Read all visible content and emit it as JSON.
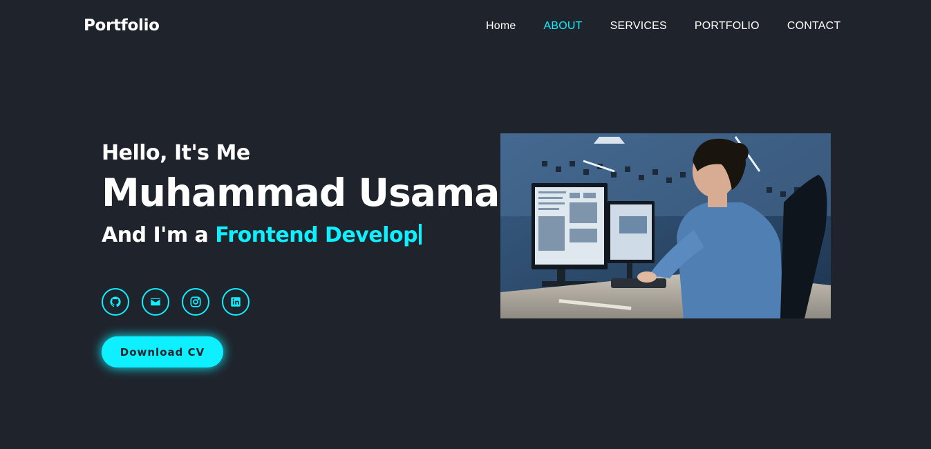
{
  "header": {
    "logo": "Portfolio",
    "nav": [
      {
        "label": "Home",
        "active": false
      },
      {
        "label": "ABOUT",
        "active": true
      },
      {
        "label": "SERVICES",
        "active": false
      },
      {
        "label": "PORTFOLIO",
        "active": false
      },
      {
        "label": "CONTACT",
        "active": false
      }
    ]
  },
  "hero": {
    "greeting": "Hello, It's Me",
    "name": "Muhammad Usama",
    "role_prefix": "And I'm a ",
    "role_typed": "Frontend Develop",
    "download_label": "Download CV",
    "socials": [
      {
        "icon": "github-icon"
      },
      {
        "icon": "mail-icon"
      },
      {
        "icon": "instagram-icon"
      },
      {
        "icon": "linkedin-icon"
      }
    ]
  },
  "colors": {
    "background": "#1f232c",
    "accent": "#0ef0ff",
    "text": "#ffffff"
  }
}
